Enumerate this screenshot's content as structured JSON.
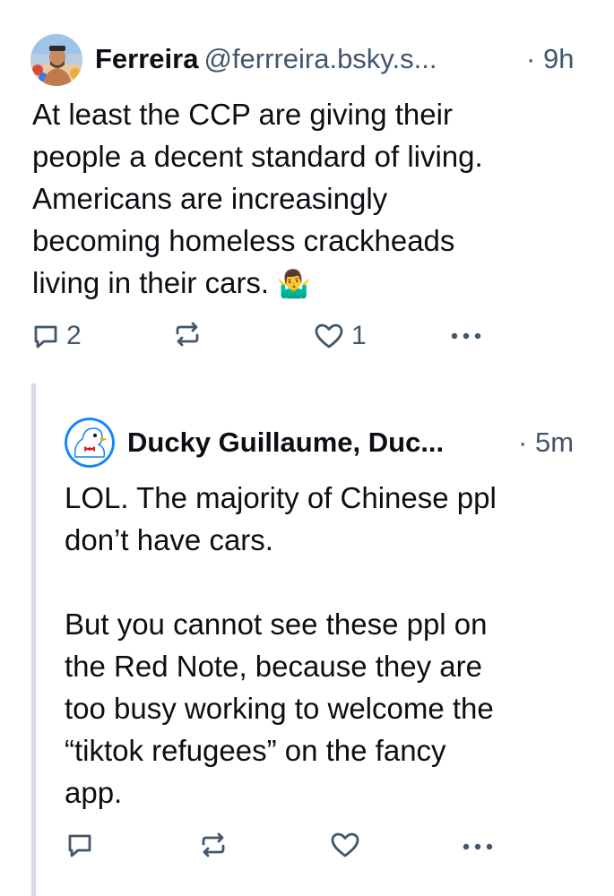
{
  "post1": {
    "author_name": "Ferreira",
    "handle": "@ferrreira.bsky.s...",
    "separator": "·",
    "time": "9h",
    "text": "At least the CCP are giving their\npeople a decent standard of living.\nAmericans are increasingly\nbecoming homeless crackheads\nliving in their cars. ",
    "emoji": "🤷‍♂️",
    "reply_count": "2",
    "repost_count": "",
    "like_count": "1"
  },
  "post2": {
    "author_name": "Ducky Guillaume, Duc...",
    "separator": "·",
    "time": "5m",
    "text": "LOL. The majority of Chinese ppl\ndon’t have cars.\n\nBut you cannot see these ppl on\nthe Red Note, because they are\ntoo busy working to welcome the\n“tiktok refugees” on the fancy\napp.",
    "reply_count": "",
    "repost_count": "",
    "like_count": ""
  },
  "colors": {
    "text": "#0b0f14",
    "muted": "#42576c",
    "thread_line": "#d4dbe2",
    "duck_blue": "#1185fe"
  },
  "icons": [
    "avatar-photo",
    "duck-avatar",
    "reply-icon",
    "repost-icon",
    "like-icon",
    "more-icon"
  ]
}
